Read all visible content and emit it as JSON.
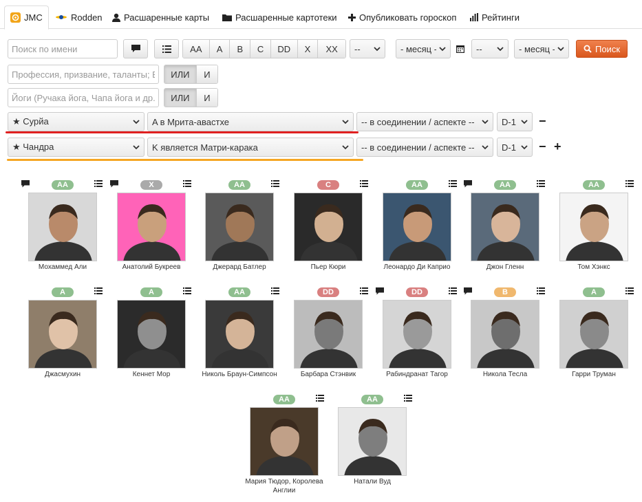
{
  "colors": {
    "rating": {
      "AA": "#8fbf8f",
      "A": "#8fbf8f",
      "X": "#aaaaaa",
      "C": "#d98080",
      "DD": "#d98080",
      "B": "#f0b86e"
    },
    "underline1": "#e02020",
    "underline2": "#f5a623",
    "accent": "#e06a30"
  },
  "tabs": [
    {
      "label": "JMC",
      "icon": "jmc-logo-icon"
    },
    {
      "label": "Rodden",
      "icon": "rodden-sun-icon"
    },
    {
      "label": "Расшаренные карты",
      "icon": "user-icon"
    },
    {
      "label": "Расшаренные картотеки",
      "icon": "folder-icon"
    },
    {
      "label": "Опубликовать гороскоп",
      "icon": "plus-icon"
    },
    {
      "label": "Рейтинги",
      "icon": "bar-chart-icon"
    }
  ],
  "filters": {
    "name_placeholder": "Поиск по имени",
    "ratings": [
      "AA",
      "A",
      "B",
      "C",
      "DD",
      "X",
      "XX"
    ],
    "day1": "--",
    "month1": "- месяц -",
    "day2": "--",
    "month2": "- месяц -",
    "search_label": "Поиск",
    "profession_placeholder": "Профессия, призвание, таланты; Е",
    "yoga_placeholder": "Йоги (Ручака йога, Чапа йога и др.)",
    "or_label": "ИЛИ",
    "and_label": "И",
    "row1": {
      "planet": "★ Сурйа",
      "condition": "A в Мрита-авастхе",
      "relation": "-- в соединении / аспекте --",
      "chart": "D-1"
    },
    "row2": {
      "planet": "★ Чандра",
      "condition": "K является Матри-карака",
      "relation": "-- в соединении / аспекте --",
      "chart": "D-1"
    },
    "minus": "−",
    "plus": "+"
  },
  "people": [
    {
      "name": "Мохаммед Али",
      "rating": "AA",
      "comment": true
    },
    {
      "name": "Анатолий Букреев",
      "rating": "X",
      "comment": true
    },
    {
      "name": "Джерард Батлер",
      "rating": "AA",
      "comment": false
    },
    {
      "name": "Пьер Кюри",
      "rating": "C",
      "comment": false
    },
    {
      "name": "Леонардо Ди Каприо",
      "rating": "AA",
      "comment": false
    },
    {
      "name": "Джон Гленн",
      "rating": "AA",
      "comment": true
    },
    {
      "name": "Том Хэнкс",
      "rating": "AA",
      "comment": false
    },
    {
      "name": "Джасмухин",
      "rating": "A",
      "comment": false
    },
    {
      "name": "Кеннет Мор",
      "rating": "A",
      "comment": false
    },
    {
      "name": "Николь Браун-Симпсон",
      "rating": "AA",
      "comment": false
    },
    {
      "name": "Барбара Стэнвик",
      "rating": "DD",
      "comment": false
    },
    {
      "name": "Рабиндранат Тагор",
      "rating": "DD",
      "comment": true
    },
    {
      "name": "Никола Тесла",
      "rating": "B",
      "comment": true
    },
    {
      "name": "Гарри Труман",
      "rating": "A",
      "comment": false
    },
    {
      "name": "Мария Тюдор, Королева Англии",
      "rating": "AA",
      "comment": false
    },
    {
      "name": "Натали Вуд",
      "rating": "AA",
      "comment": false
    }
  ]
}
